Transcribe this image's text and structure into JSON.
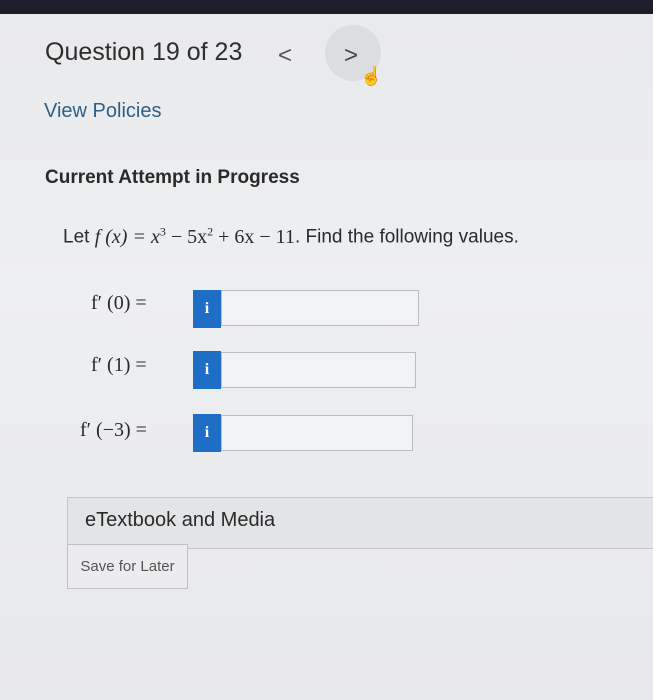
{
  "header": {
    "question_title": "Question 19 of 23",
    "prev_glyph": "<",
    "next_glyph": ">"
  },
  "links": {
    "view_policies": "View Policies"
  },
  "attempt": {
    "heading": "Current Attempt in Progress"
  },
  "problem": {
    "lead": "Let ",
    "function_text": "f (x) = x",
    "exp1": "3",
    "mid": " − 5x",
    "exp2": "2",
    "rest": " + 6x − 11",
    "tail": ". Find the following values."
  },
  "answers": [
    {
      "label": "f′ (0) =",
      "value": "",
      "info": "i"
    },
    {
      "label": "f′ (1) =",
      "value": "",
      "info": "i"
    },
    {
      "label": "f′ (−3) =",
      "value": "",
      "info": "i"
    }
  ],
  "resources": {
    "etextbook_label": "eTextbook and Media"
  },
  "actions": {
    "save_label": "Save for Later"
  },
  "colors": {
    "info_button": "#1f6ec6",
    "link": "#2f5f86",
    "topbar": "#1b1e2a"
  },
  "icons": {
    "cursor": "hand-pointer-icon"
  }
}
